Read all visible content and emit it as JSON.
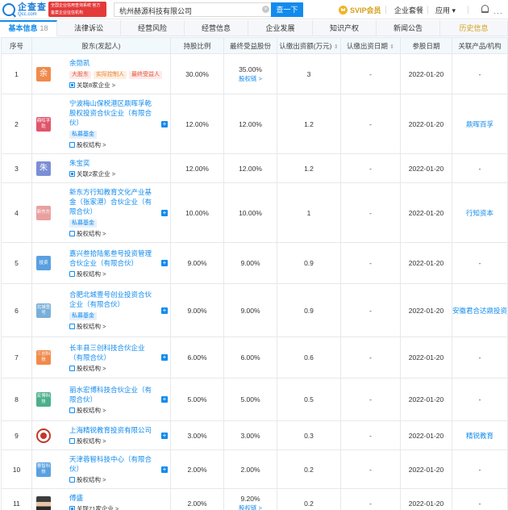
{
  "header": {
    "logo_cn": "企查查",
    "logo_en": "Qcc.com",
    "badge_text": "全国企业信用查询系统 官方备案企业征信机构",
    "search_value": "杭州赫源科技有限公司",
    "search_button": "查一下",
    "svip": "SVIP会员",
    "nav_items": [
      "企业套餐",
      "应用 ▾"
    ],
    "clear_glyph": "×",
    "more_glyph": "···"
  },
  "tabs": [
    {
      "label": "基本信息",
      "count": "18"
    },
    {
      "label": "法律诉讼"
    },
    {
      "label": "经营风险"
    },
    {
      "label": "经营信息"
    },
    {
      "label": "企业发展"
    },
    {
      "label": "知识产权"
    },
    {
      "label": "新闻公告"
    },
    {
      "label": "历史信息"
    }
  ],
  "columns": [
    "序号",
    "股东(发起人)",
    "持股比例",
    "最终受益股份",
    "认缴出资额(万元)",
    "认缴出资日期",
    "参股日期",
    "关联产品/机构"
  ],
  "sort_glyph": "⇕",
  "rows": [
    {
      "no": "1",
      "avatar_text": "余",
      "avatar_color": "#f08a4b",
      "name": "余勋凯",
      "tags": [
        {
          "t": "大股东",
          "c": "red"
        },
        {
          "t": "实际控制人",
          "c": "orange"
        },
        {
          "t": "最终受益人",
          "c": "red"
        }
      ],
      "link": "关联8家企业 >",
      "ratio": "30.00%",
      "final": "35.00%",
      "final_link": "股权链 >",
      "amount": "3",
      "date1": "-",
      "date2": "2022-01-20",
      "product": "-"
    },
    {
      "no": "2",
      "avatar_text": "鼎晖孚乾",
      "avatar_color": "#e0556b",
      "name": "宁波梅山保税港区鼎晖孚乾股权投资合伙企业（有限合伙）",
      "tags": [
        {
          "t": "私募基金",
          "c": "blue"
        }
      ],
      "link": "股权结构 >",
      "ratio": "12.00%",
      "final": "12.00%",
      "amount": "1.2",
      "date1": "-",
      "date2": "2022-01-20",
      "product": "鼎晖百孚",
      "plus": true
    },
    {
      "no": "3",
      "avatar_text": "朱",
      "avatar_color": "#7b8fd6",
      "name": "朱宝奕",
      "tags": [],
      "link": "关联2家企业 >",
      "ratio": "12.00%",
      "final": "12.00%",
      "amount": "1.2",
      "date1": "-",
      "date2": "2022-01-20",
      "product": "-"
    },
    {
      "no": "4",
      "avatar_text": "新东方",
      "avatar_color": "#e9a0a0",
      "name": "新东方行知教育文化产业基金（张家港）合伙企业（有限合伙）",
      "tags": [
        {
          "t": "私募基金",
          "c": "blue"
        }
      ],
      "link": "股权结构 >",
      "ratio": "10.00%",
      "final": "10.00%",
      "amount": "1",
      "date1": "-",
      "date2": "2022-01-20",
      "product": "行知资本",
      "plus": true
    },
    {
      "no": "5",
      "avatar_text": "投资",
      "avatar_color": "#5aa0e0",
      "name": "嘉兴叁拾陆氪叁号投资管理合伙企业（有限合伙）",
      "tags": [],
      "link": "股权结构 >",
      "ratio": "9.00%",
      "final": "9.00%",
      "amount": "0.9",
      "date1": "-",
      "date2": "2022-01-20",
      "product": "-",
      "plus": true
    },
    {
      "no": "6",
      "avatar_text": "北城壹号",
      "avatar_color": "#7ab0d8",
      "name": "合肥北城壹号创业投资合伙企业（有限合伙）",
      "tags": [
        {
          "t": "私募基金",
          "c": "blue"
        }
      ],
      "link": "股权结构 >",
      "ratio": "9.00%",
      "final": "9.00%",
      "amount": "0.9",
      "date1": "-",
      "date2": "2022-01-20",
      "product": "安徽君合达鼎投资",
      "plus": true
    },
    {
      "no": "7",
      "avatar_text": "三创科技",
      "avatar_color": "#f08a4b",
      "name": "长丰县三创科技合伙企业（有限合伙）",
      "tags": [],
      "link": "股权结构 >",
      "ratio": "6.00%",
      "final": "6.00%",
      "amount": "0.6",
      "date1": "-",
      "date2": "2022-01-20",
      "product": "-",
      "plus": true
    },
    {
      "no": "8",
      "avatar_text": "宏博科技",
      "avatar_color": "#4bb08a",
      "name": "丽水宏博科技合伙企业（有限合伙）",
      "tags": [],
      "link": "股权结构 >",
      "ratio": "5.00%",
      "final": "5.00%",
      "amount": "0.5",
      "date1": "-",
      "date2": "2022-01-20",
      "product": "-",
      "plus": true
    },
    {
      "no": "9",
      "avatar_text": "",
      "avatar_color": "#c0392b",
      "avatar_ring": true,
      "name": "上海精锐教育投资有限公司",
      "tags": [],
      "link": "股权结构 >",
      "ratio": "3.00%",
      "final": "3.00%",
      "amount": "0.3",
      "date1": "-",
      "date2": "2022-01-20",
      "product": "精锐教育",
      "plus": true
    },
    {
      "no": "10",
      "avatar_text": "蓉智科技",
      "avatar_color": "#5aa0e0",
      "name": "天津蓉智科技中心（有限合伙）",
      "tags": [],
      "link": "股权结构 >",
      "ratio": "2.00%",
      "final": "2.00%",
      "amount": "0.2",
      "date1": "-",
      "date2": "2022-01-20",
      "product": "-",
      "plus": true
    },
    {
      "no": "11",
      "avatar_text": "",
      "avatar_color": "#555",
      "avatar_photo": true,
      "name": "傅盛",
      "tags": [],
      "link": "关联71家企业 >",
      "ratio": "2.00%",
      "final": "9.20%",
      "final_link": "股权链 >",
      "amount": "0.2",
      "date1": "-",
      "date2": "2022-01-20",
      "product": "-"
    }
  ]
}
